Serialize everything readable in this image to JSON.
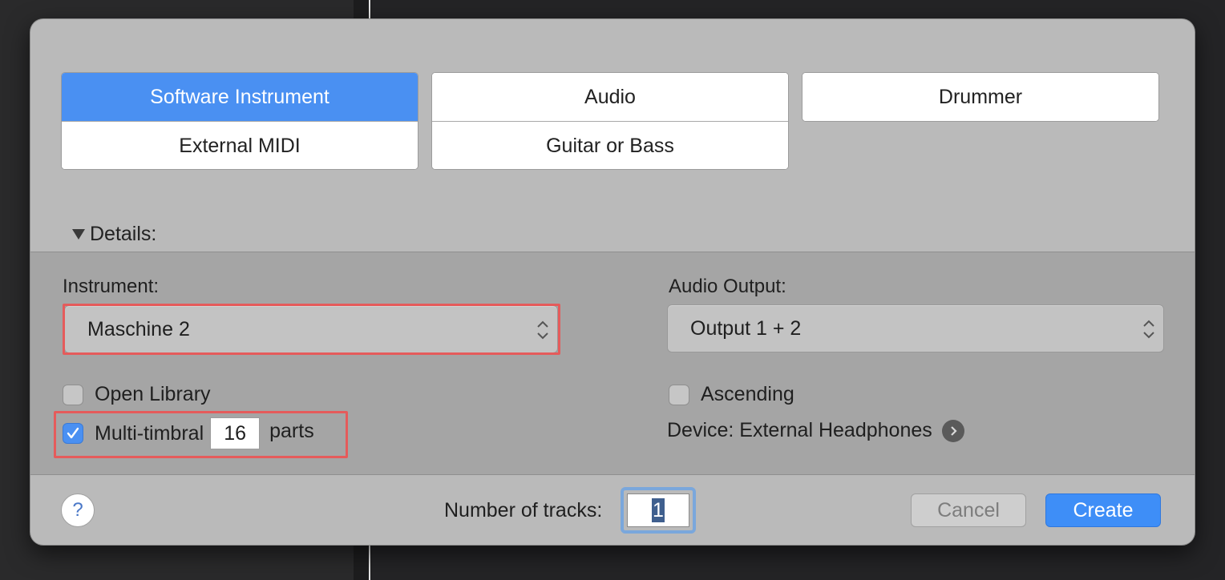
{
  "track_types": {
    "software_instrument": "Software Instrument",
    "external_midi": "External MIDI",
    "audio": "Audio",
    "guitar_or_bass": "Guitar or Bass",
    "drummer": "Drummer"
  },
  "details": {
    "toggle_label": "Details:",
    "instrument_label": "Instrument:",
    "instrument_value": "Maschine 2",
    "audio_output_label": "Audio Output:",
    "audio_output_value": "Output 1 + 2",
    "open_library_label": "Open Library",
    "open_library_checked": false,
    "ascending_label": "Ascending",
    "ascending_checked": false,
    "multi_timbral_label": "Multi-timbral",
    "multi_timbral_checked": true,
    "parts_value": "16",
    "parts_label": "parts",
    "device_label": "Device: External Headphones"
  },
  "footer": {
    "help_label": "?",
    "tracks_label": "Number of tracks:",
    "tracks_value": "1",
    "cancel_label": "Cancel",
    "create_label": "Create"
  },
  "colors": {
    "selected_tile": "#4a90f2",
    "highlight_outline": "#e55b5b",
    "create_button": "#3e8ef7"
  }
}
